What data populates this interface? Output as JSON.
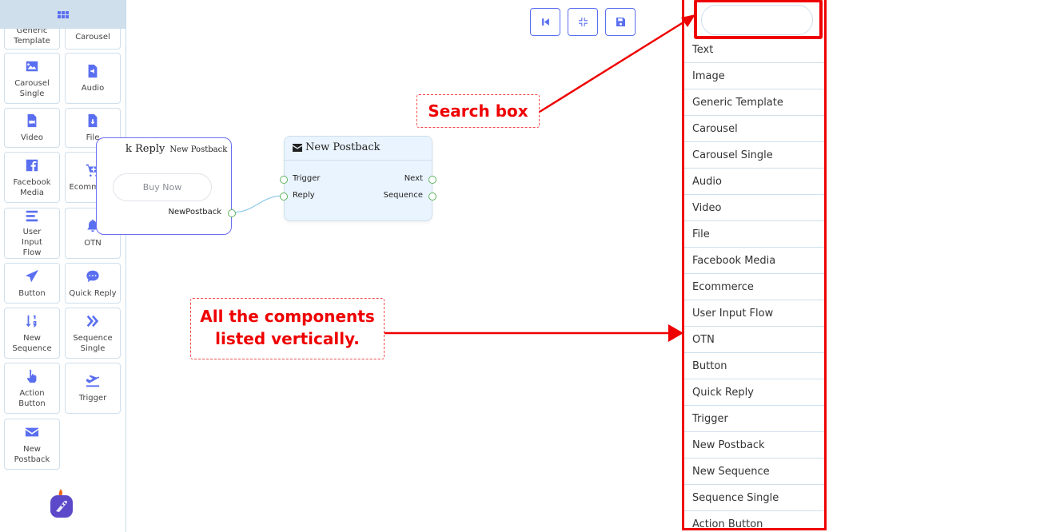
{
  "sidebar": {
    "header_icon": "grid-icon",
    "tiles": [
      {
        "label": "Generic Template",
        "icon": "layout-icon"
      },
      {
        "label": "Carousel",
        "icon": "carousel-icon"
      },
      {
        "label": "Carousel Single",
        "icon": "image-icon"
      },
      {
        "label": "Audio",
        "icon": "audio-file-icon"
      },
      {
        "label": "Video",
        "icon": "video-file-icon"
      },
      {
        "label": "File",
        "icon": "download-file-icon"
      },
      {
        "label": "Facebook Media",
        "icon": "facebook-icon"
      },
      {
        "label": "Ecommerce",
        "icon": "cart-plus-icon"
      },
      {
        "label": "User Input Flow",
        "icon": "bars-icon"
      },
      {
        "label": "OTN",
        "icon": "bell-icon"
      },
      {
        "label": "Button",
        "icon": "paper-plane-icon"
      },
      {
        "label": "Quick Reply",
        "icon": "chat-bubble-icon"
      },
      {
        "label": "New Sequence",
        "icon": "sort-numeric-icon"
      },
      {
        "label": "Sequence Single",
        "icon": "double-chevron-right-icon"
      },
      {
        "label": "Action Button",
        "icon": "hand-pointer-icon"
      },
      {
        "label": "Trigger",
        "icon": "plane-departure-icon"
      },
      {
        "label": "New Postback",
        "icon": "envelope-icon"
      }
    ],
    "logo": "rocket-logo"
  },
  "canvas": {
    "quick_reply_node": {
      "title": "k Reply",
      "subtitle": "New Postback",
      "button_label": "Buy Now",
      "output_label": "NewPostback"
    },
    "postback_node": {
      "title": "New Postback",
      "icon": "envelope-icon",
      "inputs": [
        "Trigger",
        "Reply"
      ],
      "outputs": [
        "Next",
        "Sequence"
      ]
    }
  },
  "toolbar": {
    "buttons": [
      {
        "name": "first-page",
        "icon": "skip-back-icon"
      },
      {
        "name": "fit-screen",
        "icon": "compress-icon"
      },
      {
        "name": "save",
        "icon": "save-icon"
      }
    ]
  },
  "component_list": {
    "search_placeholder": "",
    "search_value": "",
    "items": [
      "Text",
      "Image",
      "Generic Template",
      "Carousel",
      "Carousel Single",
      "Audio",
      "Video",
      "File",
      "Facebook Media",
      "Ecommerce",
      "User Input Flow",
      "OTN",
      "Button",
      "Quick Reply",
      "Trigger",
      "New Postback",
      "New Sequence",
      "Sequence Single",
      "Action Button"
    ]
  },
  "annotations": {
    "search_box": "Search box",
    "list_line1": "All the components",
    "list_line2": "listed vertically.",
    "color": "#ef0000"
  },
  "colors": {
    "accent": "#5a6ff0",
    "port": "#5fb35f",
    "node_bg": "#eaf4fe",
    "sidebar_header": "#cfdfec"
  }
}
